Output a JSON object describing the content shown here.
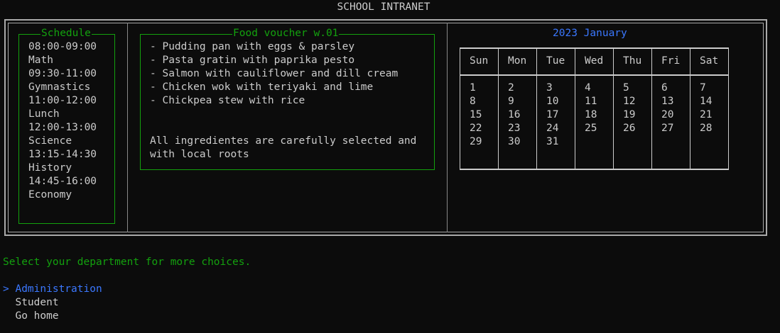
{
  "app": {
    "title": "SCHOOL INTRANET"
  },
  "schedule": {
    "title": "Schedule",
    "entries": [
      {
        "time": "08:00-09:00",
        "subject": "Math"
      },
      {
        "time": "09:30-11:00",
        "subject": "Gymnastics"
      },
      {
        "time": "11:00-12:00",
        "subject": "Lunch"
      },
      {
        "time": "12:00-13:00",
        "subject": "Science"
      },
      {
        "time": "13:15-14:30",
        "subject": "History"
      },
      {
        "time": "14:45-16:00",
        "subject": "Economy"
      }
    ]
  },
  "food": {
    "title": "Food voucher w.01",
    "items": [
      "- Pudding pan with eggs & parsley",
      "- Pasta gratin with paprika pesto",
      "- Salmon with cauliflower and dill cream",
      "- Chicken wok with teriyaki and lime",
      "- Chickpea stew with rice"
    ],
    "note_line1": "All ingredientes are carefully selected and",
    "note_line2": "with local roots"
  },
  "calendar": {
    "title": "2023 January",
    "weekdays": [
      "Sun",
      "Mon",
      "Tue",
      "Wed",
      "Thu",
      "Fri",
      "Sat"
    ],
    "weeks": [
      [
        "1",
        "2",
        "3",
        "4",
        "5",
        "6",
        "7"
      ],
      [
        "8",
        "9",
        "10",
        "11",
        "12",
        "13",
        "14"
      ],
      [
        "15",
        "16",
        "17",
        "18",
        "19",
        "20",
        "21"
      ],
      [
        "22",
        "23",
        "24",
        "25",
        "26",
        "27",
        "28"
      ],
      [
        "29",
        "30",
        "31",
        "",
        "",
        "",
        ""
      ]
    ]
  },
  "prompt": "Select your department for more choices.",
  "menu": {
    "cursor": ">",
    "items": [
      "Administration",
      "Student",
      "Go home"
    ],
    "selected": "Administration"
  },
  "colors": {
    "accent_green": "#13a10e",
    "accent_blue": "#3b78ff",
    "text": "#cccccc",
    "background": "#0c0c0c"
  }
}
